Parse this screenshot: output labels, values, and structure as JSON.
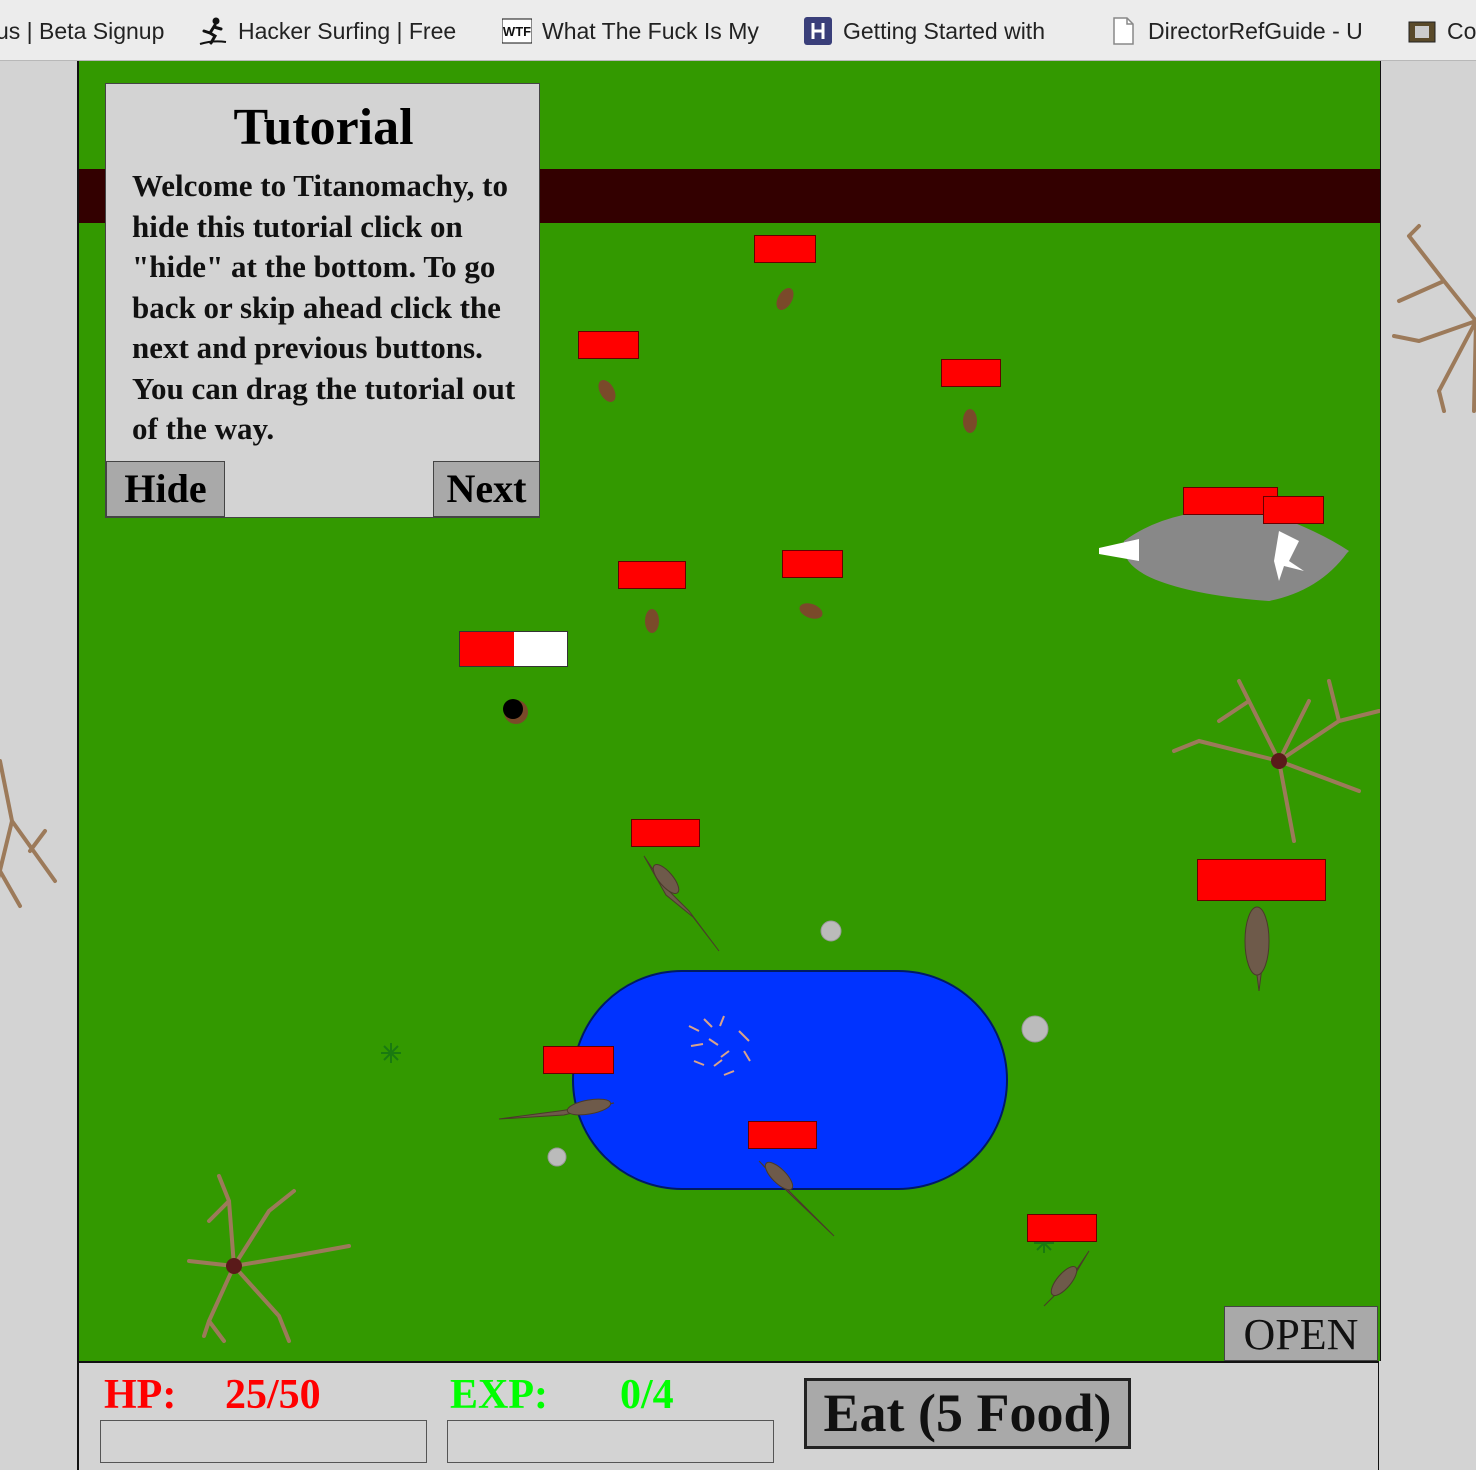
{
  "bookmarks": [
    {
      "label": "us | Beta Signup",
      "icon": "none"
    },
    {
      "label": "Hacker Surfing | Free",
      "icon": "surfer-icon"
    },
    {
      "label": "What The Fuck Is My",
      "icon": "wtf-logo-icon"
    },
    {
      "label": "Getting Started with",
      "icon": "hackerrank-icon"
    },
    {
      "label": "DirectorRefGuide - U",
      "icon": "document-icon"
    },
    {
      "label": "Co",
      "icon": "folder-icon"
    }
  ],
  "tutorial": {
    "title": "Tutorial",
    "text": "Welcome to Titanomachy, to hide this tutorial click on \"hide\" at the bottom. To go back or skip ahead click the next and previous buttons. You can drag the tutorial out of the way.",
    "hide_label": "Hide",
    "next_label": "Next"
  },
  "open_label": "OPEN",
  "hud": {
    "hp_label": "HP:",
    "hp_value": "25/50",
    "hp_fraction": 0.5,
    "exp_label": "EXP:",
    "exp_value": "0/4",
    "exp_fraction": 0,
    "eat_label": "Eat (5 Food)"
  },
  "colors": {
    "grass": "#339900",
    "road": "#330000",
    "water": "#0033ff",
    "health_bar": "#ff0000",
    "hp_text": "#ff0000",
    "exp_text": "#00ff00"
  },
  "player_health_fraction": 0.5
}
